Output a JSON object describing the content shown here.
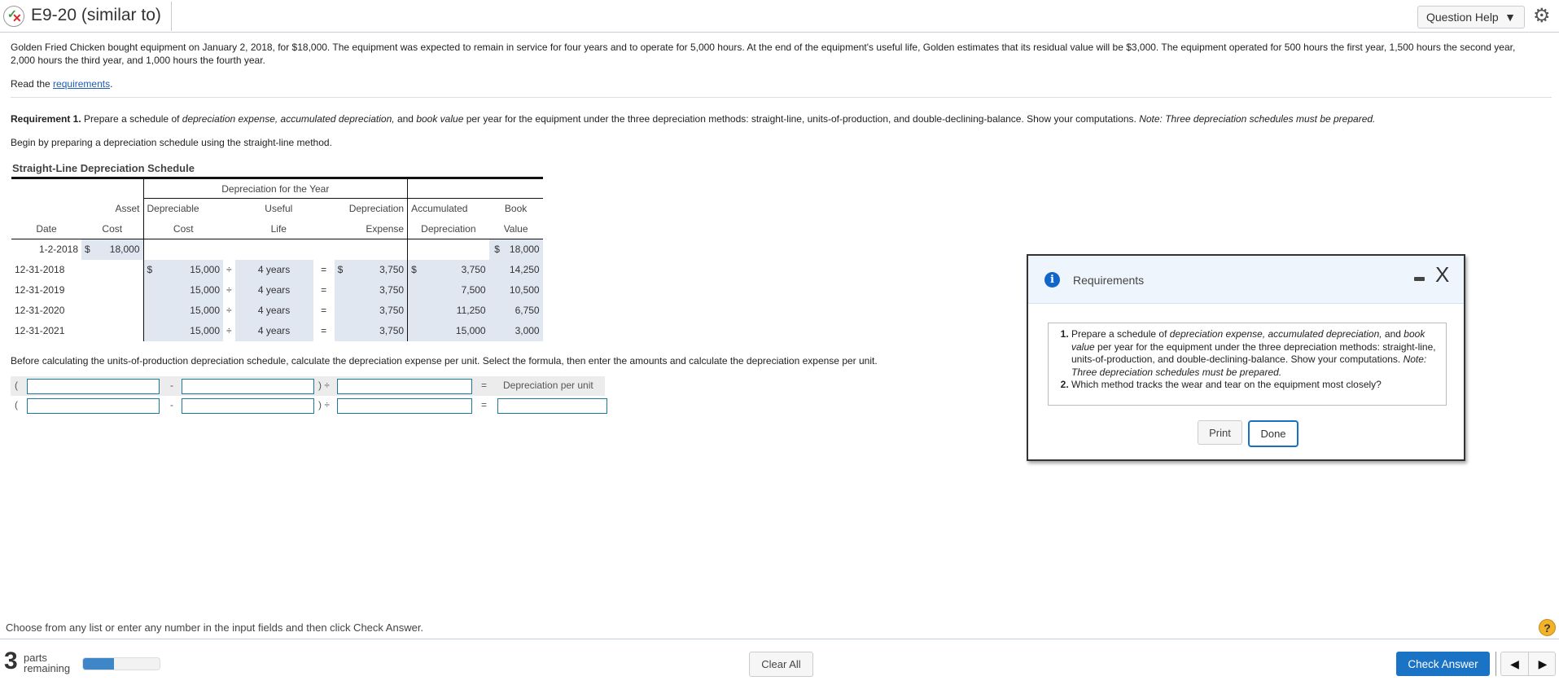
{
  "header": {
    "title": "E9-20 (similar to)",
    "question_help_label": "Question Help",
    "question_help_arrow": "▼",
    "gear_glyph": "⚙"
  },
  "problem": {
    "intro": "Golden Fried Chicken bought equipment on January 2, 2018, for $18,000. The equipment was expected to remain in service for four years and to operate for 5,000 hours. At the end of the equipment's useful life, Golden estimates that its residual value will be $3,000. The equipment operated for 500 hours the first year, 1,500 hours the second year, 2,000 hours the third year, and 1,000 hours the fourth year.",
    "read_prefix": "Read the ",
    "read_link": "requirements",
    "read_suffix": ".",
    "req1_label": "Requirement 1.",
    "req1_text_a": " Prepare a schedule of ",
    "req1_italic_a": "depreciation expense, accumulated depreciation,",
    "req1_text_b": " and ",
    "req1_italic_b": "book value",
    "req1_text_c": " per year for the equipment under the three depreciation methods: straight-line, units-of-production, and double-declining-balance. Show your computations. ",
    "req1_note": "Note: Three depreciation schedules must be prepared.",
    "begin_text": "Begin by preparing a depreciation schedule using the straight-line method."
  },
  "schedule": {
    "title": "Straight-Line Depreciation Schedule",
    "group_header": "Depreciation for the Year",
    "headers": {
      "date": "Date",
      "asset_cost_1": "Asset",
      "asset_cost_2": "Cost",
      "dep_cost_1": "Depreciable",
      "dep_cost_2": "Cost",
      "useful_life_1": "Useful",
      "useful_life_2": "Life",
      "dep_exp_1": "Depreciation",
      "dep_exp_2": "Expense",
      "accum_1": "Accumulated",
      "accum_2": "Depreciation",
      "book_1": "Book",
      "book_2": "Value"
    },
    "initial_row": {
      "date": "1-2-2018",
      "cur": "$",
      "asset_cost": "18,000",
      "book_cur": "$",
      "book_value": "18,000"
    },
    "rows": [
      {
        "date": "12-31-2018",
        "dep_cur": "$",
        "dep_cost": "15,000",
        "div": "÷",
        "life": "4 years",
        "eq": "=",
        "exp_cur": "$",
        "expense": "3,750",
        "acc_cur": "$",
        "accum": "3,750",
        "book": "14,250"
      },
      {
        "date": "12-31-2019",
        "dep_cur": "",
        "dep_cost": "15,000",
        "div": "÷",
        "life": "4 years",
        "eq": "=",
        "exp_cur": "",
        "expense": "3,750",
        "acc_cur": "",
        "accum": "7,500",
        "book": "10,500"
      },
      {
        "date": "12-31-2020",
        "dep_cur": "",
        "dep_cost": "15,000",
        "div": "÷",
        "life": "4 years",
        "eq": "=",
        "exp_cur": "",
        "expense": "3,750",
        "acc_cur": "",
        "accum": "11,250",
        "book": "6,750"
      },
      {
        "date": "12-31-2021",
        "dep_cur": "",
        "dep_cost": "15,000",
        "div": "÷",
        "life": "4 years",
        "eq": "=",
        "exp_cur": "",
        "expense": "3,750",
        "acc_cur": "",
        "accum": "15,000",
        "book": "3,000"
      }
    ]
  },
  "units_of_production": {
    "instruction": "Before calculating the units-of-production depreciation schedule, calculate the depreciation expense per unit. Select the formula, then enter the amounts and calculate the depreciation expense per unit.",
    "open_paren": "(",
    "minus": "-",
    "close_div": ") ÷",
    "equals": "=",
    "result_label": "Depreciation per unit",
    "row1_values": [
      "",
      "",
      ""
    ],
    "row2_values": [
      "",
      "",
      "",
      ""
    ]
  },
  "modal": {
    "title": "Requirements",
    "info_glyph": "i",
    "close_glyph": "X",
    "item1_a": "Prepare a schedule of ",
    "item1_italic_a": "depreciation expense, accumulated depreciation,",
    "item1_b": " and ",
    "item1_italic_b": "book value",
    "item1_c": " per year for the equipment under the three depreciation methods: straight-line, units-of-production, and double-declining-balance. Show your computations. ",
    "item1_note": "Note: Three depreciation schedules must be prepared.",
    "item2": "Which method tracks the wear and tear on the equipment most closely?",
    "print_label": "Print",
    "done_label": "Done"
  },
  "footer": {
    "instruction": "Choose from any list or enter any number in the input fields and then click Check Answer.",
    "help_glyph": "?",
    "parts_count": "3",
    "parts_label_1": "parts",
    "parts_label_2": "remaining",
    "progress_fraction": 0.4,
    "clear_all_label": "Clear All",
    "check_answer_label": "Check Answer",
    "prev_glyph": "◀",
    "next_glyph": "▶"
  }
}
